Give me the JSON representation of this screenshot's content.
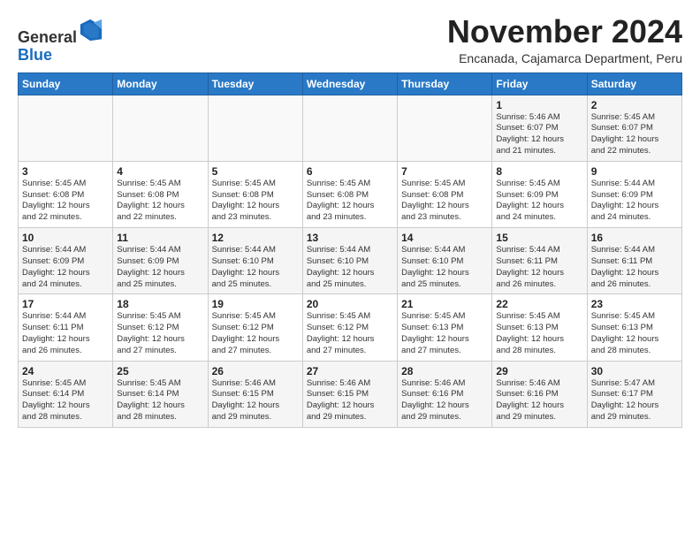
{
  "header": {
    "logo_general": "General",
    "logo_blue": "Blue",
    "month_title": "November 2024",
    "location": "Encanada, Cajamarca Department, Peru"
  },
  "calendar": {
    "weekdays": [
      "Sunday",
      "Monday",
      "Tuesday",
      "Wednesday",
      "Thursday",
      "Friday",
      "Saturday"
    ],
    "weeks": [
      [
        {
          "day": "",
          "detail": ""
        },
        {
          "day": "",
          "detail": ""
        },
        {
          "day": "",
          "detail": ""
        },
        {
          "day": "",
          "detail": ""
        },
        {
          "day": "",
          "detail": ""
        },
        {
          "day": "1",
          "detail": "Sunrise: 5:46 AM\nSunset: 6:07 PM\nDaylight: 12 hours\nand 21 minutes."
        },
        {
          "day": "2",
          "detail": "Sunrise: 5:45 AM\nSunset: 6:07 PM\nDaylight: 12 hours\nand 22 minutes."
        }
      ],
      [
        {
          "day": "3",
          "detail": "Sunrise: 5:45 AM\nSunset: 6:08 PM\nDaylight: 12 hours\nand 22 minutes."
        },
        {
          "day": "4",
          "detail": "Sunrise: 5:45 AM\nSunset: 6:08 PM\nDaylight: 12 hours\nand 22 minutes."
        },
        {
          "day": "5",
          "detail": "Sunrise: 5:45 AM\nSunset: 6:08 PM\nDaylight: 12 hours\nand 23 minutes."
        },
        {
          "day": "6",
          "detail": "Sunrise: 5:45 AM\nSunset: 6:08 PM\nDaylight: 12 hours\nand 23 minutes."
        },
        {
          "day": "7",
          "detail": "Sunrise: 5:45 AM\nSunset: 6:08 PM\nDaylight: 12 hours\nand 23 minutes."
        },
        {
          "day": "8",
          "detail": "Sunrise: 5:45 AM\nSunset: 6:09 PM\nDaylight: 12 hours\nand 24 minutes."
        },
        {
          "day": "9",
          "detail": "Sunrise: 5:44 AM\nSunset: 6:09 PM\nDaylight: 12 hours\nand 24 minutes."
        }
      ],
      [
        {
          "day": "10",
          "detail": "Sunrise: 5:44 AM\nSunset: 6:09 PM\nDaylight: 12 hours\nand 24 minutes."
        },
        {
          "day": "11",
          "detail": "Sunrise: 5:44 AM\nSunset: 6:09 PM\nDaylight: 12 hours\nand 25 minutes."
        },
        {
          "day": "12",
          "detail": "Sunrise: 5:44 AM\nSunset: 6:10 PM\nDaylight: 12 hours\nand 25 minutes."
        },
        {
          "day": "13",
          "detail": "Sunrise: 5:44 AM\nSunset: 6:10 PM\nDaylight: 12 hours\nand 25 minutes."
        },
        {
          "day": "14",
          "detail": "Sunrise: 5:44 AM\nSunset: 6:10 PM\nDaylight: 12 hours\nand 25 minutes."
        },
        {
          "day": "15",
          "detail": "Sunrise: 5:44 AM\nSunset: 6:11 PM\nDaylight: 12 hours\nand 26 minutes."
        },
        {
          "day": "16",
          "detail": "Sunrise: 5:44 AM\nSunset: 6:11 PM\nDaylight: 12 hours\nand 26 minutes."
        }
      ],
      [
        {
          "day": "17",
          "detail": "Sunrise: 5:44 AM\nSunset: 6:11 PM\nDaylight: 12 hours\nand 26 minutes."
        },
        {
          "day": "18",
          "detail": "Sunrise: 5:45 AM\nSunset: 6:12 PM\nDaylight: 12 hours\nand 27 minutes."
        },
        {
          "day": "19",
          "detail": "Sunrise: 5:45 AM\nSunset: 6:12 PM\nDaylight: 12 hours\nand 27 minutes."
        },
        {
          "day": "20",
          "detail": "Sunrise: 5:45 AM\nSunset: 6:12 PM\nDaylight: 12 hours\nand 27 minutes."
        },
        {
          "day": "21",
          "detail": "Sunrise: 5:45 AM\nSunset: 6:13 PM\nDaylight: 12 hours\nand 27 minutes."
        },
        {
          "day": "22",
          "detail": "Sunrise: 5:45 AM\nSunset: 6:13 PM\nDaylight: 12 hours\nand 28 minutes."
        },
        {
          "day": "23",
          "detail": "Sunrise: 5:45 AM\nSunset: 6:13 PM\nDaylight: 12 hours\nand 28 minutes."
        }
      ],
      [
        {
          "day": "24",
          "detail": "Sunrise: 5:45 AM\nSunset: 6:14 PM\nDaylight: 12 hours\nand 28 minutes."
        },
        {
          "day": "25",
          "detail": "Sunrise: 5:45 AM\nSunset: 6:14 PM\nDaylight: 12 hours\nand 28 minutes."
        },
        {
          "day": "26",
          "detail": "Sunrise: 5:46 AM\nSunset: 6:15 PM\nDaylight: 12 hours\nand 29 minutes."
        },
        {
          "day": "27",
          "detail": "Sunrise: 5:46 AM\nSunset: 6:15 PM\nDaylight: 12 hours\nand 29 minutes."
        },
        {
          "day": "28",
          "detail": "Sunrise: 5:46 AM\nSunset: 6:16 PM\nDaylight: 12 hours\nand 29 minutes."
        },
        {
          "day": "29",
          "detail": "Sunrise: 5:46 AM\nSunset: 6:16 PM\nDaylight: 12 hours\nand 29 minutes."
        },
        {
          "day": "30",
          "detail": "Sunrise: 5:47 AM\nSunset: 6:17 PM\nDaylight: 12 hours\nand 29 minutes."
        }
      ]
    ]
  }
}
